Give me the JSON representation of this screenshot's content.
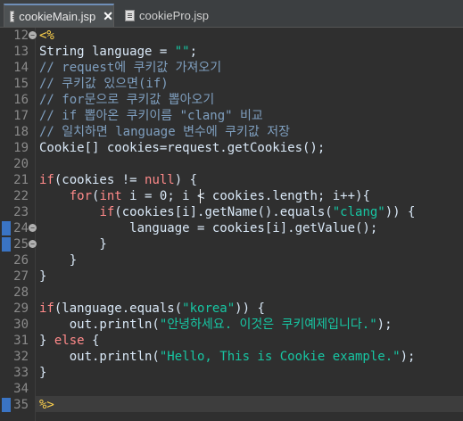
{
  "tabs": [
    {
      "label": "cookieMain.jsp",
      "active": true,
      "icon": "jsp-file-icon"
    },
    {
      "label": "cookiePro.jsp",
      "active": false,
      "icon": "jsp-file-icon"
    }
  ],
  "tab_close_symbol": "✕",
  "colors": {
    "keyword": "#ff8a8a",
    "string": "#17c6a3",
    "comment": "#7f9fbf",
    "jsp_tag": "#ffd34d",
    "text": "#d9e8f7",
    "background": "#2f2f2f"
  },
  "current_line": 35,
  "lines": [
    {
      "n": "12",
      "segs": [
        [
          "tag",
          "<%"
        ]
      ]
    },
    {
      "n": "13",
      "segs": [
        [
          "txt",
          "String language = "
        ],
        [
          "str",
          "\"\""
        ],
        [
          "txt",
          ";"
        ]
      ]
    },
    {
      "n": "14",
      "segs": [
        [
          "cm",
          "// request에 쿠키값 가져오기"
        ]
      ]
    },
    {
      "n": "15",
      "segs": [
        [
          "cm",
          "// 쿠키값 있으면(if)"
        ]
      ]
    },
    {
      "n": "16",
      "segs": [
        [
          "cm",
          "// for문으로 쿠키값 뽑아오기"
        ]
      ]
    },
    {
      "n": "17",
      "segs": [
        [
          "cm",
          "// if 뽑아온 쿠키이름 \"clang\" 비교"
        ]
      ]
    },
    {
      "n": "18",
      "segs": [
        [
          "cm",
          "// 일치하면 language 변수에 쿠키값 저장"
        ]
      ]
    },
    {
      "n": "19",
      "segs": [
        [
          "txt",
          "Cookie[] cookies=request.getCookies();"
        ]
      ]
    },
    {
      "n": "20",
      "segs": []
    },
    {
      "n": "21",
      "segs": [
        [
          "kw",
          "if"
        ],
        [
          "txt",
          "(cookies != "
        ],
        [
          "kw",
          "null"
        ],
        [
          "txt",
          ") {"
        ]
      ]
    },
    {
      "n": "22",
      "segs": [
        [
          "txt",
          "    "
        ],
        [
          "kw",
          "for"
        ],
        [
          "txt",
          "("
        ],
        [
          "kw",
          "int"
        ],
        [
          "txt",
          " i = 0; i < cookies.length; i++){"
        ]
      ]
    },
    {
      "n": "23",
      "segs": [
        [
          "txt",
          "        "
        ],
        [
          "kw",
          "if"
        ],
        [
          "txt",
          "(cookies[i].getName().equals("
        ],
        [
          "str",
          "\"clang\""
        ],
        [
          "txt",
          ")) {"
        ]
      ]
    },
    {
      "n": "24",
      "segs": [
        [
          "txt",
          "            language = cookies[i].getValue();"
        ]
      ]
    },
    {
      "n": "25",
      "segs": [
        [
          "txt",
          "        }"
        ]
      ]
    },
    {
      "n": "26",
      "segs": [
        [
          "txt",
          "    }"
        ]
      ]
    },
    {
      "n": "27",
      "segs": [
        [
          "txt",
          "}"
        ]
      ]
    },
    {
      "n": "28",
      "segs": []
    },
    {
      "n": "29",
      "segs": [
        [
          "kw",
          "if"
        ],
        [
          "txt",
          "(language.equals("
        ],
        [
          "str",
          "\"korea\""
        ],
        [
          "txt",
          ")) {"
        ]
      ]
    },
    {
      "n": "30",
      "segs": [
        [
          "txt",
          "    out.println("
        ],
        [
          "str",
          "\"안녕하세요. 이것은 쿠키예제입니다.\""
        ],
        [
          "txt",
          ");"
        ]
      ]
    },
    {
      "n": "31",
      "segs": [
        [
          "txt",
          "} "
        ],
        [
          "kw",
          "else"
        ],
        [
          "txt",
          " {"
        ]
      ]
    },
    {
      "n": "32",
      "segs": [
        [
          "txt",
          "    out.println("
        ],
        [
          "str",
          "\"Hello, This is Cookie example.\""
        ],
        [
          "txt",
          ");"
        ]
      ]
    },
    {
      "n": "33",
      "segs": [
        [
          "txt",
          "}"
        ]
      ]
    },
    {
      "n": "34",
      "segs": []
    },
    {
      "n": "35",
      "segs": [
        [
          "tag",
          "%>"
        ]
      ]
    }
  ]
}
